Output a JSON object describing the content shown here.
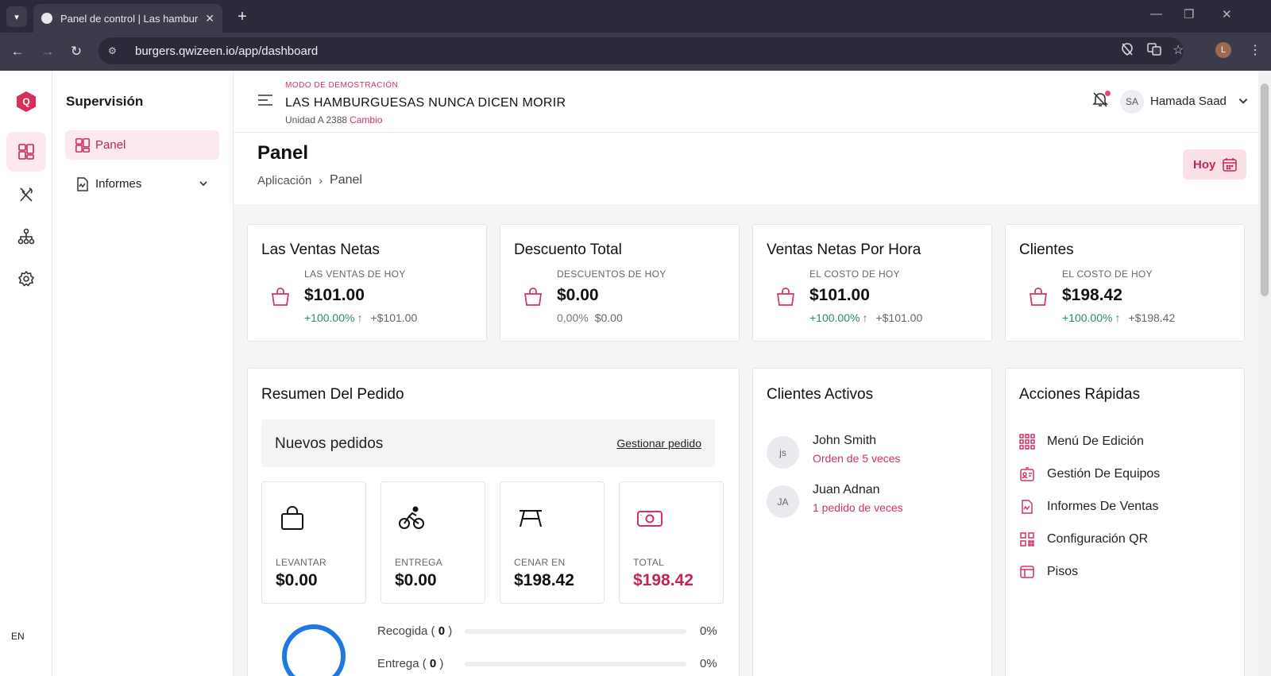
{
  "browser": {
    "tab_title": "Panel de control | Las hamburguesas nunca dicen morir",
    "url": "burgers.qwizeen.io/app/dashboard",
    "profile_initial": "L"
  },
  "rail": {
    "logo_letter": "Q",
    "language": "EN",
    "items": [
      "dashboard-icon",
      "utensils-icon",
      "org-chart-icon",
      "gear-icon"
    ]
  },
  "sidebar": {
    "title": "Supervisión",
    "items": [
      {
        "label": "Panel",
        "active": true
      },
      {
        "label": "Informes",
        "active": false
      }
    ]
  },
  "header": {
    "demo_mode": "MODO DE DEMOSTRACIÓN",
    "store_name": "LAS HAMBURGUESAS NUNCA DICEN MORIR",
    "unit": "Unidad A 2388",
    "change_link": "Cambio",
    "user_initials": "SA",
    "user_name": "Hamada Saad"
  },
  "page": {
    "title": "Panel",
    "breadcrumb": [
      "Aplicación",
      "Panel"
    ],
    "today_button": "Hoy"
  },
  "stats": [
    {
      "title": "Las Ventas Netas",
      "label": "LAS VENTAS DE HOY",
      "value": "$101.00",
      "pct": "+100.00%",
      "up": true,
      "abs": "+$101.00"
    },
    {
      "title": "Descuento Total",
      "label": "DESCUENTOS DE HOY",
      "value": "$0.00",
      "pct": "0,00%",
      "up": false,
      "abs": "$0.00"
    },
    {
      "title": "Ventas Netas Por Hora",
      "label": "EL COSTO DE HOY",
      "value": "$101.00",
      "pct": "+100.00%",
      "up": true,
      "abs": "+$101.00"
    },
    {
      "title": "Clientes",
      "label": "EL COSTO DE HOY",
      "value": "$198.42",
      "pct": "+100.00%",
      "up": true,
      "abs": "+$198.42"
    }
  ],
  "order_summary": {
    "title": "Resumen Del Pedido",
    "new_orders_label": "Nuevos pedidos",
    "manage_link": "Gestionar pedido",
    "types": [
      {
        "label": "LEVANTAR",
        "value": "$0.00",
        "icon": "shopping-bag-icon"
      },
      {
        "label": "ENTREGA",
        "value": "$0.00",
        "icon": "bicycle-icon"
      },
      {
        "label": "CENAR EN",
        "value": "$198.42",
        "icon": "table-icon"
      },
      {
        "label": "TOTAL",
        "value": "$198.42",
        "icon": "money-icon"
      }
    ],
    "progress": [
      {
        "label": "Recogida",
        "count": "0",
        "pct": "0%"
      },
      {
        "label": "Entrega",
        "count": "0",
        "pct": "0%"
      }
    ]
  },
  "active_clients": {
    "title": "Clientes Activos",
    "clients": [
      {
        "initials": "js",
        "name": "John Smith",
        "orders": "Orden de 5 veces"
      },
      {
        "initials": "JA",
        "name": "Juan Adnan",
        "orders": "1 pedido de veces"
      }
    ]
  },
  "quick_actions": {
    "title": "Acciones Rápidas",
    "items": [
      {
        "label": "Menú De Edición",
        "icon": "grid-icon"
      },
      {
        "label": "Gestión De Equipos",
        "icon": "id-card-icon"
      },
      {
        "label": "Informes De Ventas",
        "icon": "report-icon"
      },
      {
        "label": "Configuración QR",
        "icon": "qr-code-icon"
      },
      {
        "label": "Pisos",
        "icon": "floor-plan-icon"
      }
    ]
  },
  "colors": {
    "accent": "#d2335f",
    "positive": "#2e8b57",
    "ring": "#1e78e0"
  }
}
